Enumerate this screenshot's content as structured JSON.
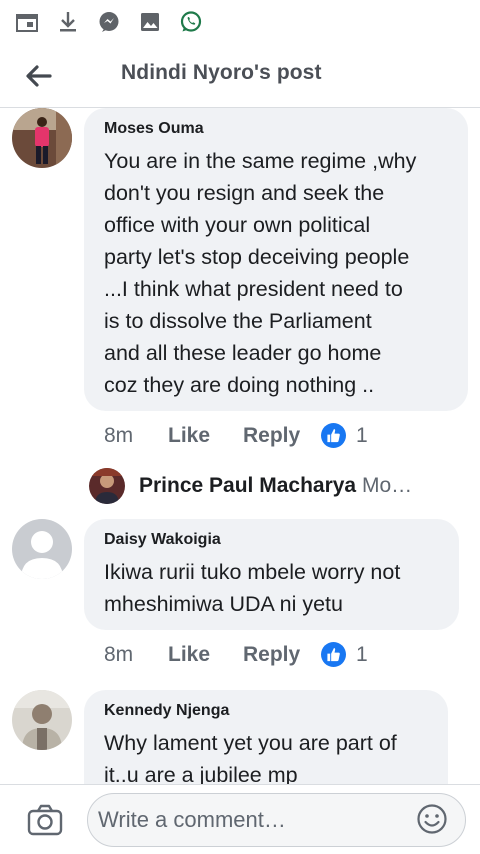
{
  "status_bar": {
    "icons": [
      "calendar-icon",
      "download-icon",
      "messenger-icon",
      "gallery-icon",
      "whatsapp-icon"
    ]
  },
  "header": {
    "title": "Ndindi Nyoro's post",
    "back_icon": "arrow-left-icon"
  },
  "comments": [
    {
      "author": "Moses Ouma",
      "text": "You are in the same regime ,why\ndon't you resign and seek the\noffice with your own political\nparty let's stop deceiving people\n...I think what president need to\nis to dissolve the Parliament\nand all these leader go home\ncoz they are doing nothing ..",
      "time": "8m",
      "like_label": "Like",
      "reply_label": "Reply",
      "reaction_count": "1",
      "reply": {
        "author": "Prince Paul Macharya",
        "snippet": "Mo…"
      }
    },
    {
      "author": "Daisy Wakoigia",
      "text": "Ikiwa rurii tuko mbele worry not\nmheshimiwa UDA ni yetu",
      "time": "8m",
      "like_label": "Like",
      "reply_label": "Reply",
      "reaction_count": "1"
    },
    {
      "author": "Kennedy Njenga",
      "text": "Why lament yet you are part of\nit..u are a jubilee mp"
    }
  ],
  "composer": {
    "placeholder": "Write a comment…"
  },
  "colors": {
    "bubble": "#f0f2f5",
    "reaction_blue": "#1877f2",
    "whatsapp_green": "#25d366",
    "icon_gray": "#5f6368"
  }
}
